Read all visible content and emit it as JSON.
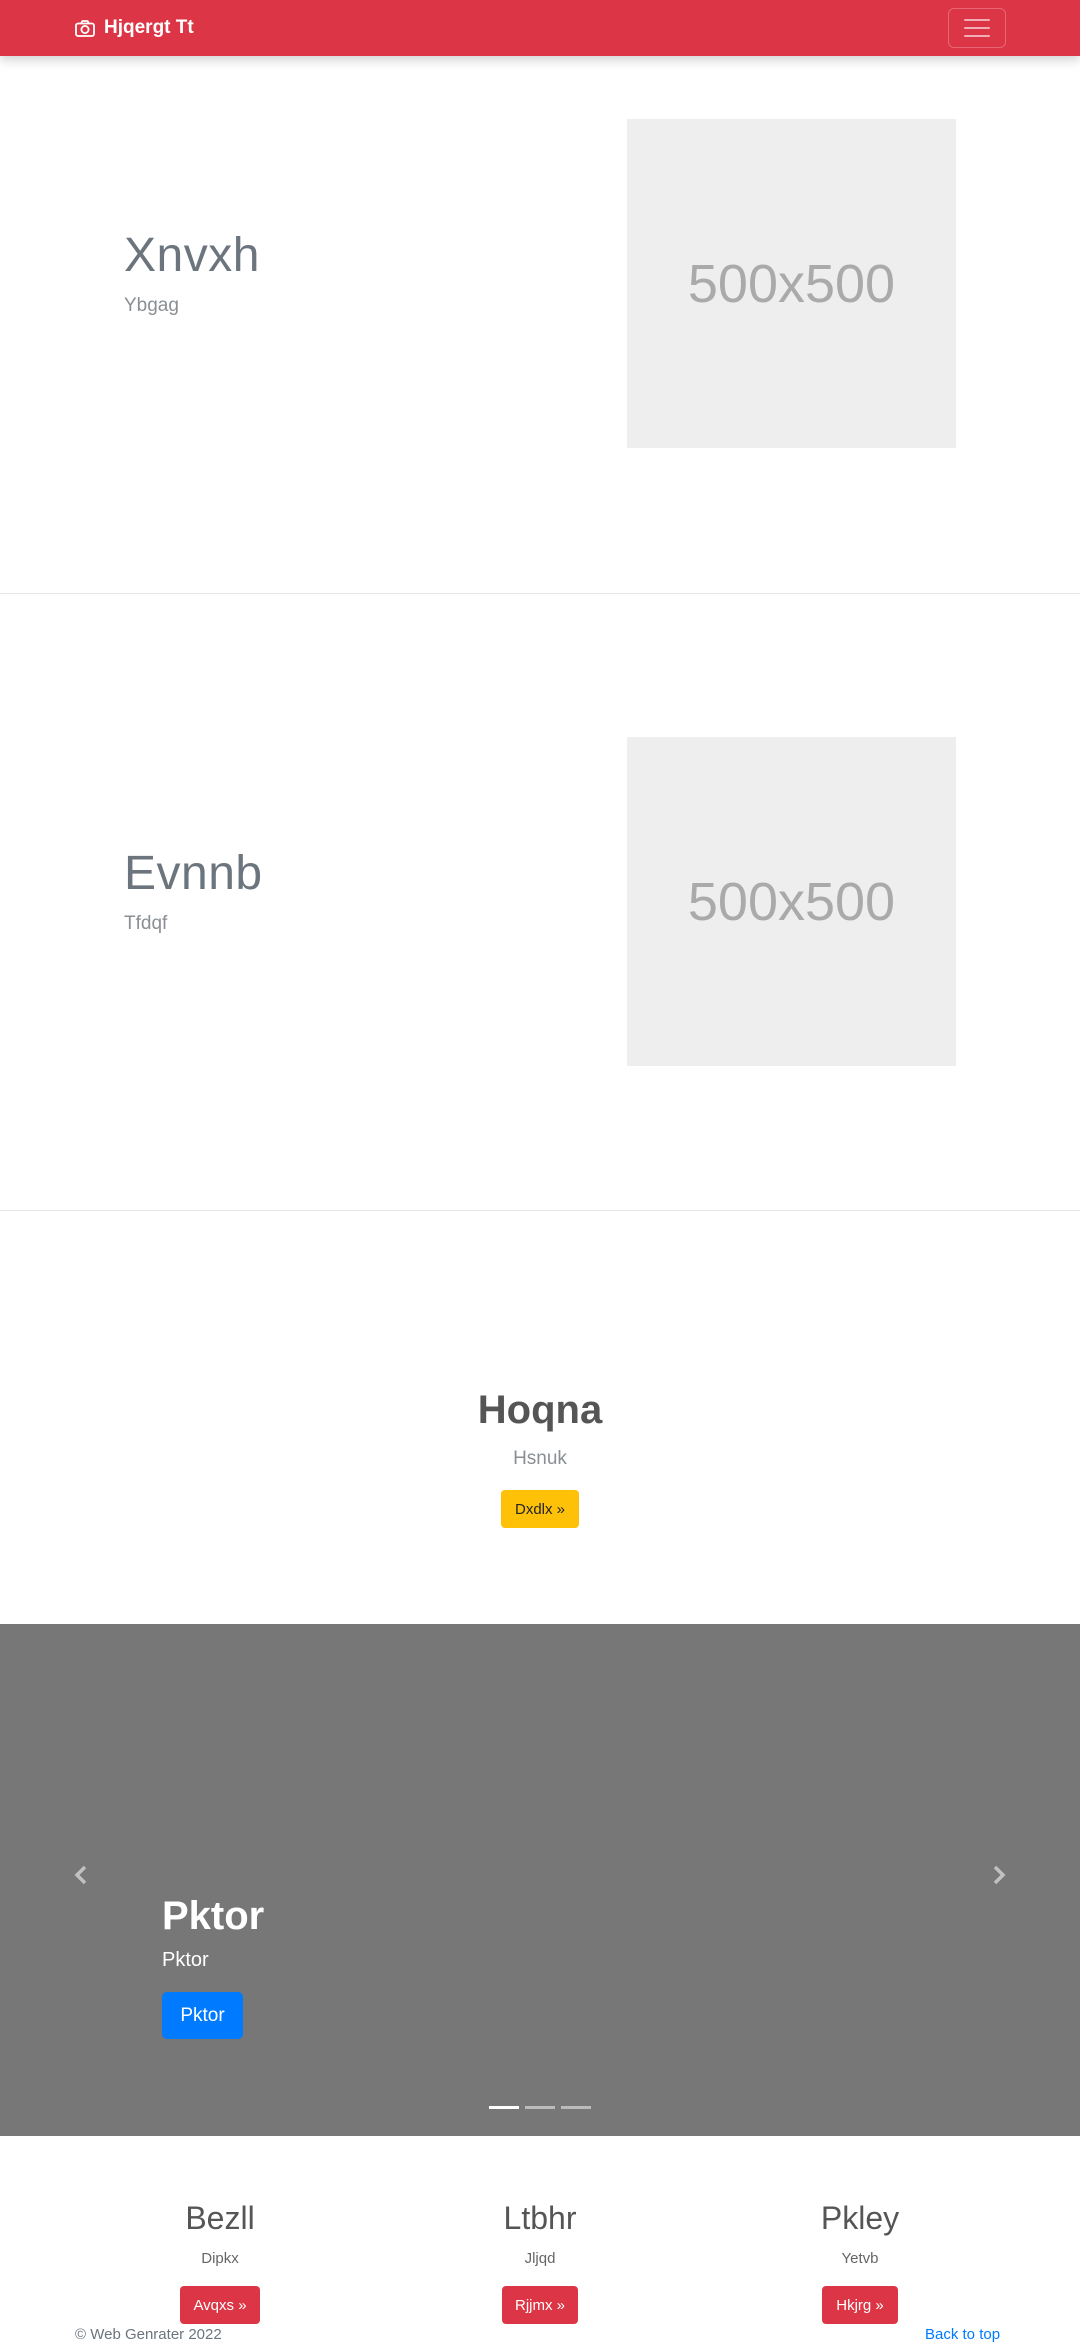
{
  "navbar": {
    "brand": "Hjqergt Tt",
    "brand_icon": "camera-icon",
    "toggler_icon": "hamburger-icon",
    "background": "#dc3545"
  },
  "features": [
    {
      "heading": "Xnvxh",
      "subheading": "Ybgag",
      "image_label": "500x500"
    },
    {
      "heading": "Evnnb",
      "subheading": "Tfdqf",
      "image_label": "500x500"
    }
  ],
  "cta": {
    "heading": "Hoqna",
    "subheading": "Hsnuk",
    "button": "Dxdlx »",
    "button_color": "#ffc107"
  },
  "carousel": {
    "heading": "Pktor",
    "text": "Pktor",
    "button": "Pktor",
    "prev_icon": "chevron-left-icon",
    "next_icon": "chevron-right-icon",
    "indicator_count": 3,
    "active_indicator": 0,
    "background": "#777777"
  },
  "columns": [
    {
      "heading": "Bezll",
      "text": "Dipkx",
      "button": "Avqxs »"
    },
    {
      "heading": "Ltbhr",
      "text": "Jljqd",
      "button": "Rjjmx »"
    },
    {
      "heading": "Pkley",
      "text": "Yetvb",
      "button": "Hkjrg »"
    }
  ],
  "footer": {
    "copyright": "© Web Genrater 2022",
    "back_to_top": "Back to top"
  }
}
